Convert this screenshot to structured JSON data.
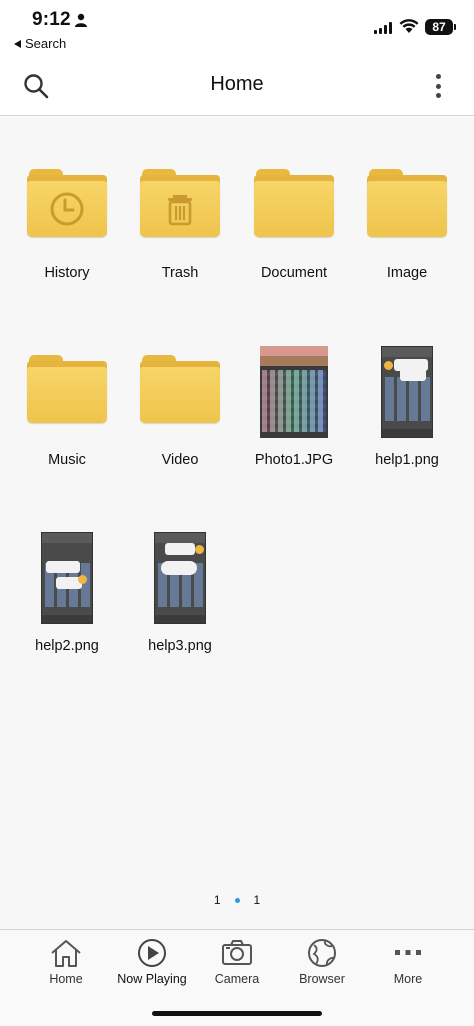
{
  "status_bar": {
    "time": "9:12",
    "back_app": "Search",
    "battery": "87"
  },
  "nav": {
    "title": "Home",
    "icons": [
      "search-icon",
      "more-vertical-icon"
    ]
  },
  "items": [
    {
      "label": "History",
      "kind": "folder",
      "emblem": "clock-icon"
    },
    {
      "label": "Trash",
      "kind": "folder",
      "emblem": "trash-icon"
    },
    {
      "label": "Document",
      "kind": "folder"
    },
    {
      "label": "Image",
      "kind": "folder"
    },
    {
      "label": "Music",
      "kind": "folder"
    },
    {
      "label": "Video",
      "kind": "folder"
    },
    {
      "label": "Photo1.JPG",
      "kind": "image"
    },
    {
      "label": "help1.png",
      "kind": "image"
    },
    {
      "label": "help2.png",
      "kind": "image"
    },
    {
      "label": "help3.png",
      "kind": "image"
    }
  ],
  "pager": {
    "left": "1",
    "right": "1"
  },
  "tabs": [
    {
      "label": "Home",
      "icon": "home-icon"
    },
    {
      "label": "Now Playing",
      "icon": "play-circle-icon"
    },
    {
      "label": "Camera",
      "icon": "camera-icon"
    },
    {
      "label": "Browser",
      "icon": "globe-icon"
    },
    {
      "label": "More",
      "icon": "more-horizontal-icon"
    }
  ],
  "colors": {
    "folder": "#f2c94c",
    "accent": "#2a9be0",
    "background": "#f7f7f7"
  }
}
